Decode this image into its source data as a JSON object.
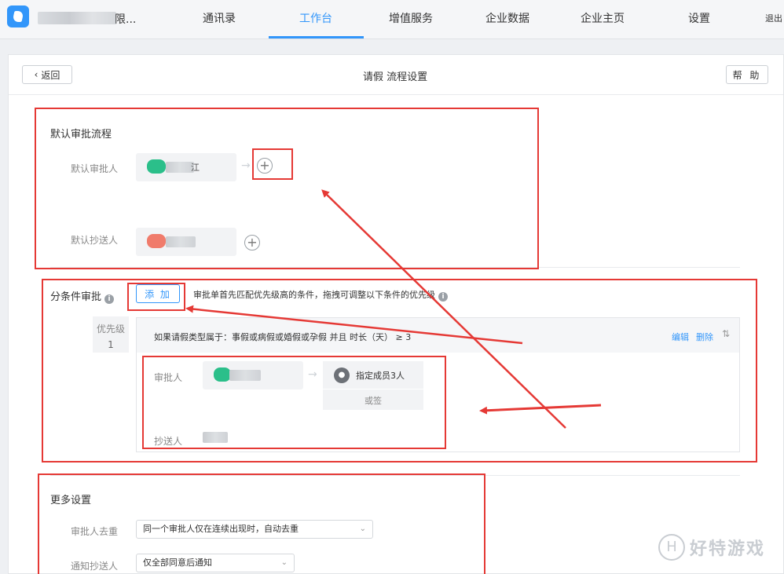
{
  "nav": {
    "company_suffix": "限...",
    "items": [
      "通讯录",
      "工作台",
      "增值服务",
      "企业数据",
      "企业主页",
      "设置"
    ],
    "active_index": 1,
    "logout": "退出"
  },
  "header": {
    "back_label": "返回",
    "title": "请假 流程设置",
    "help_label": "帮 助"
  },
  "default_flow": {
    "title": "默认审批流程",
    "approver_label": "默认审批人",
    "approver_name_tail": "江",
    "cc_label": "默认抄送人"
  },
  "conditional": {
    "title": "分条件审批",
    "add_label": "添 加",
    "hint": "审批单首先匹配优先级高的条件，拖拽可调整以下条件的优先级",
    "priority_label": "优先级",
    "priority_value": "1",
    "condition_text": "如果请假类型属于：事假或病假或婚假或孕假 并且 时长（天） ≥ 3",
    "edit_label": "编辑",
    "delete_label": "删除",
    "approver_label": "审批人",
    "member_label": "指定成员3人",
    "member_mode": "或签",
    "cc_label": "抄送人"
  },
  "more": {
    "title": "更多设置",
    "dedupe_label": "审批人去重",
    "dedupe_value": "同一个审批人仅在连续出现时，自动去重",
    "notify_label": "通知抄送人",
    "notify_value": "仅全部同意后通知"
  },
  "watermark": {
    "mark": "H",
    "text": "好特游戏"
  },
  "colors": {
    "accent": "#3296fa",
    "annotation": "#e53935",
    "avatar_green": "#2bbf8a",
    "avatar_red": "#f07b6b"
  },
  "icons": [
    "app-logo-icon",
    "chevron-left-icon",
    "plus-circle-icon",
    "info-icon",
    "drag-handle-icon",
    "member-group-icon",
    "chevron-down-icon"
  ]
}
